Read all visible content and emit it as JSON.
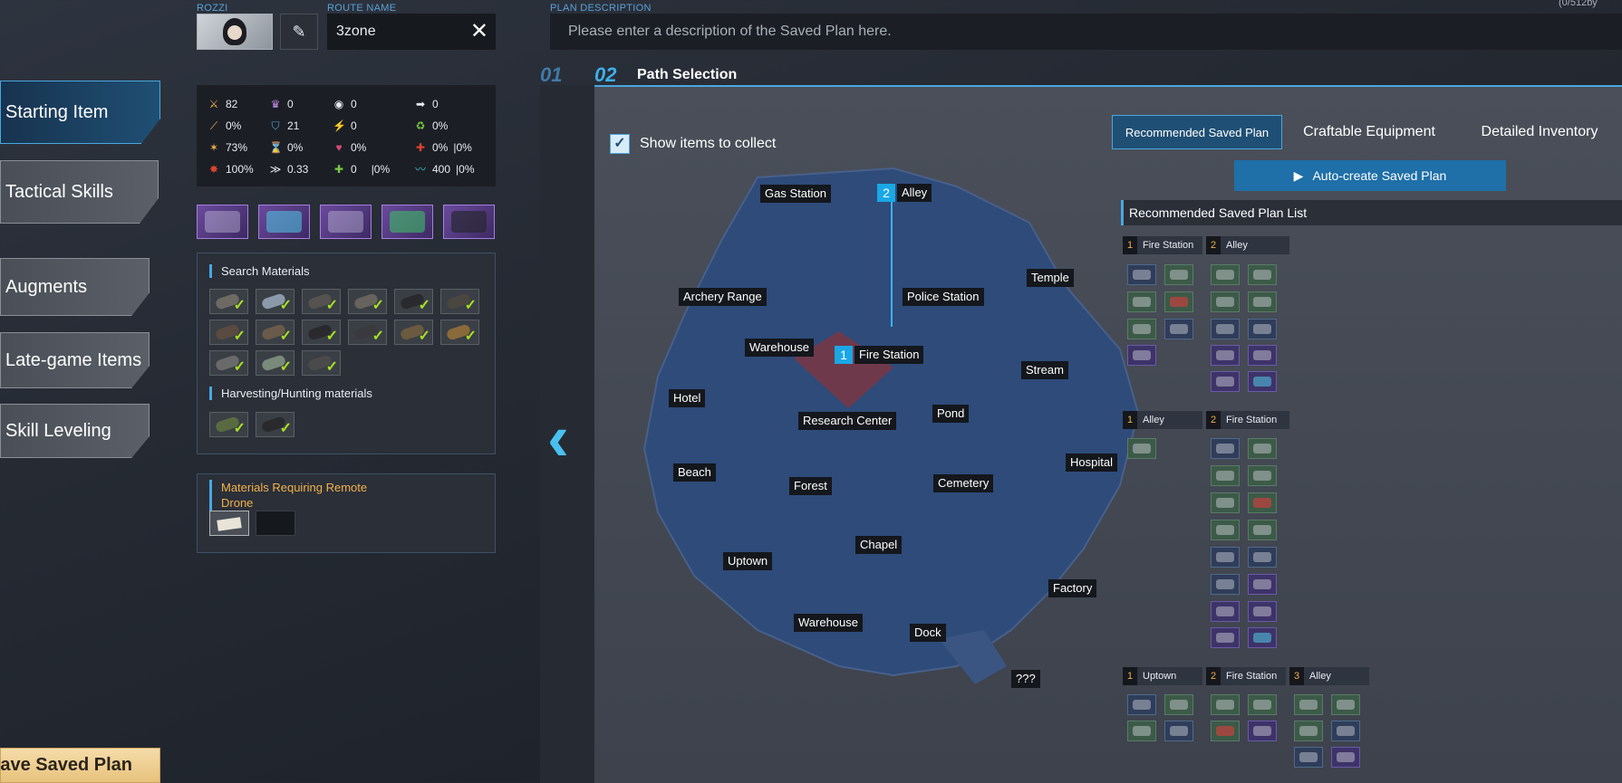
{
  "sidebar": {
    "items": [
      {
        "label": "Starting Item"
      },
      {
        "label": "Tactical Skills"
      },
      {
        "label": "Augments"
      },
      {
        "label": "Late-game Items"
      },
      {
        "label": "Skill Leveling"
      }
    ],
    "save_label": "ave Saved Plan"
  },
  "header": {
    "character_label": "ROZZI",
    "route_label": "ROUTE NAME",
    "route_name": "3zone",
    "plan_label": "PLAN DESCRIPTION",
    "plan_placeholder": "Please enter a description of the Saved Plan here.",
    "counter": "(0/512by"
  },
  "stats": [
    {
      "icon": "sword-icon",
      "value": "82"
    },
    {
      "icon": "crown-icon",
      "value": "0"
    },
    {
      "icon": "eye-icon",
      "value": "0"
    },
    {
      "icon": "arrow-icon",
      "value": "0"
    },
    {
      "icon": "pierce-icon",
      "value": "0%"
    },
    {
      "icon": "shield-icon",
      "value": "21"
    },
    {
      "icon": "blades-icon",
      "value": "0"
    },
    {
      "icon": "regen-icon",
      "value": "0%"
    },
    {
      "icon": "crit-icon",
      "value": "73%"
    },
    {
      "icon": "hourglass-icon",
      "value": "0%"
    },
    {
      "icon": "lifesteal-icon",
      "value": "0%"
    },
    {
      "icon": "heal-icon",
      "value": "0%",
      "extra": "|0%"
    },
    {
      "icon": "critdmg-icon",
      "value": "100%"
    },
    {
      "icon": "speed-icon",
      "value": "0.33"
    },
    {
      "icon": "plus-icon",
      "value": "0",
      "extra": "|0%"
    },
    {
      "icon": "stamina-icon",
      "value": "400",
      "extra": "|0%"
    }
  ],
  "equipment": [
    "pistol",
    "helmet",
    "glasses",
    "armband",
    "boots"
  ],
  "search_materials": {
    "title": "Search Materials",
    "count": 15
  },
  "harvesting": {
    "title": "Harvesting/Hunting materials",
    "count": 2
  },
  "remote_drone": {
    "title_line1": "Materials Requiring Remote",
    "title_line2": "Drone"
  },
  "steps": {
    "step1": "01",
    "step2": "02",
    "title": "Path Selection"
  },
  "show_items": "Show items to collect",
  "map_locations": [
    {
      "name": "Gas Station"
    },
    {
      "name": "Alley",
      "num": "2"
    },
    {
      "name": "Temple"
    },
    {
      "name": "Archery Range"
    },
    {
      "name": "Police Station"
    },
    {
      "name": "Warehouse"
    },
    {
      "name": "Fire Station",
      "num": "1"
    },
    {
      "name": "Stream"
    },
    {
      "name": "Hotel"
    },
    {
      "name": "Research Center"
    },
    {
      "name": "Pond"
    },
    {
      "name": "Hospital"
    },
    {
      "name": "Beach"
    },
    {
      "name": "Forest"
    },
    {
      "name": "Cemetery"
    },
    {
      "name": "Chapel"
    },
    {
      "name": "Uptown"
    },
    {
      "name": "Factory"
    },
    {
      "name": "Warehouse"
    },
    {
      "name": "Dock"
    },
    {
      "name": "???"
    }
  ],
  "tabs": [
    {
      "label": "Recommended Saved Plan"
    },
    {
      "label": "Craftable Equipment"
    },
    {
      "label": "Detailed Inventory"
    }
  ],
  "auto_create": "Auto-create Saved Plan",
  "plan_list_title": "Recommended Saved Plan List",
  "plans": [
    {
      "steps": [
        {
          "n": "1",
          "name": "Fire Station"
        },
        {
          "n": "2",
          "name": "Alley"
        }
      ]
    },
    {
      "steps": [
        {
          "n": "1",
          "name": "Alley"
        },
        {
          "n": "2",
          "name": "Fire Station"
        }
      ]
    },
    {
      "steps": [
        {
          "n": "1",
          "name": "Uptown"
        },
        {
          "n": "2",
          "name": "Fire Station"
        },
        {
          "n": "3",
          "name": "Alley"
        }
      ]
    }
  ],
  "colors": {
    "accent": "#4aa7df",
    "badge": "#1aa7e6",
    "check": "#a8e021",
    "gold": "#f3b04a"
  }
}
